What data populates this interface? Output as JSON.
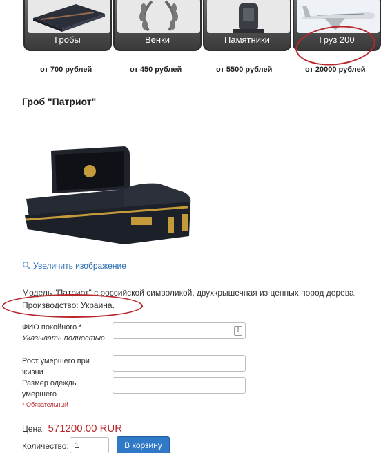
{
  "categories": [
    {
      "label": "Гробы",
      "price": "от 700 рублей",
      "icon": "coffin-thumbnail"
    },
    {
      "label": "Венки",
      "price": "от 450 рублей",
      "icon": "wreath-thumbnail"
    },
    {
      "label": "Памятники",
      "price": "от 5500 рублей",
      "icon": "monument-thumbnail"
    },
    {
      "label": "Груз 200",
      "price": "от 20000 рублей",
      "icon": "airplane-thumbnail"
    }
  ],
  "annotation_color": "#b8272c",
  "product": {
    "title": "Гроб \"Патриот\"",
    "enlarge_link": "Увеличить изображение",
    "description": "Модель \"Патриот\" с российской символикой, двухкрышечная из ценных пород дерева.",
    "origin": "Производство: Украина."
  },
  "form": {
    "fio_label": "ФИО покойного *",
    "fio_hint": "Указывать полностью",
    "height_label": "Рост умершего при жизни",
    "size_label": "Размер одежды умершего",
    "required_note": "* Обязательный"
  },
  "price": {
    "label": "Цена:",
    "value": "571200.00 RUR"
  },
  "quantity": {
    "label": "Количество:",
    "value": "1"
  },
  "cart_button": "В корзину",
  "colors": {
    "price": "#b8272c",
    "link": "#2a6db0",
    "button": "#2f79c7"
  }
}
